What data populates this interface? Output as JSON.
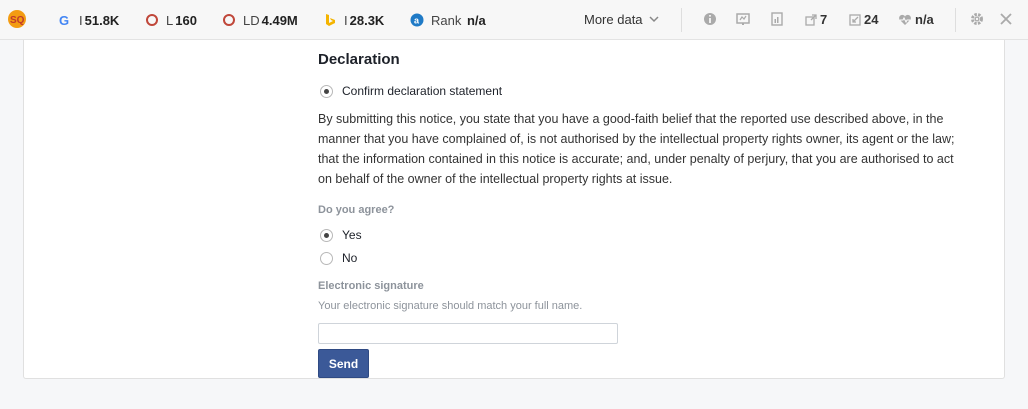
{
  "toolbar": {
    "metrics": [
      {
        "label": "I",
        "value": "51.8K"
      },
      {
        "label": "L",
        "value": "160"
      },
      {
        "label": "LD",
        "value": "4.49M"
      },
      {
        "label": "I",
        "value": "28.3K"
      },
      {
        "label": "Rank",
        "value": "n/a"
      }
    ],
    "more_data": "More data",
    "external_links": "7",
    "internal_links": "24",
    "social": "n/a"
  },
  "form": {
    "heading": "Declaration",
    "confirm_label": "Confirm declaration statement",
    "statement": "By submitting this notice, you state that you have a good-faith belief that the reported use described above, in the manner that you have complained of, is not authorised by the intellectual property rights owner, its agent or the law; that the information contained in this notice is accurate; and, under penalty of perjury, that you are authorised to act on behalf of the owner of the intellectual property rights at issue.",
    "agree_question": "Do you agree?",
    "options": [
      {
        "label": "Yes",
        "selected": true
      },
      {
        "label": "No",
        "selected": false
      }
    ],
    "signature_label": "Electronic signature",
    "signature_hint": "Your electronic signature should match your full name.",
    "signature_value": "",
    "send_label": "Send"
  }
}
